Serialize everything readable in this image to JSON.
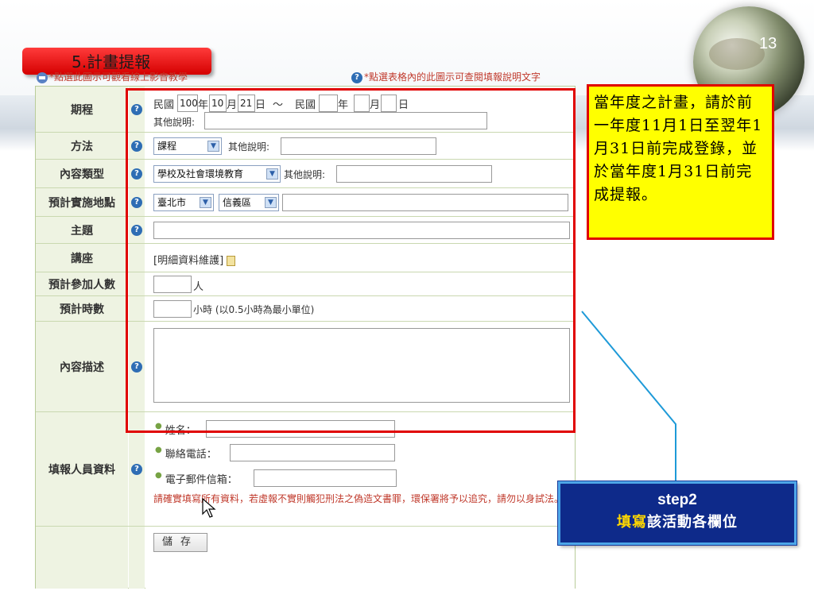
{
  "slide": {
    "page_number": "13",
    "title": "5.計畫提報"
  },
  "links": {
    "video_link": "*點選此圖示可觀看線上影音教學",
    "help_link": "*點選表格內的此圖示可查閱填報說明文字"
  },
  "form": {
    "period": {
      "label": "期程",
      "roc_prefix_1": "民國",
      "start_year": "100",
      "year_unit_1": "年",
      "start_month": "10",
      "month_unit_1": "月",
      "start_day": "21",
      "day_unit_1": "日",
      "tilde": "～",
      "roc_prefix_2": "民國",
      "year_unit_2": "年",
      "month_unit_2": "月",
      "day_unit_2": "日",
      "other_label": "其他說明:"
    },
    "method": {
      "label": "方法",
      "selected": "課程",
      "other_label": "其他說明:"
    },
    "content_type": {
      "label": "內容類型",
      "selected": "學校及社會環境教育",
      "other_label": "其他說明:"
    },
    "location": {
      "label": "預計實施地點",
      "city": "臺北市",
      "district": "信義區"
    },
    "topic": {
      "label": "主題"
    },
    "lecture": {
      "label": "講座",
      "link_text": "[明細資料維護]"
    },
    "participants": {
      "label": "預計參加人數",
      "unit": "人"
    },
    "hours": {
      "label": "預計時數",
      "unit": "小時 (以0.5小時為最小單位)"
    },
    "description": {
      "label": "內容描述"
    },
    "reporter": {
      "label": "填報人員資料",
      "name_label": "姓名：",
      "phone_label": "聯絡電話：",
      "email_label": "電子郵件信箱：",
      "warning": "請確實填寫所有資料，若虛報不實則觸犯刑法之偽造文書罪，環保署將予以追究，請勿以身試法。"
    },
    "save_label": "儲存"
  },
  "note": {
    "text": "當年度之計畫，請於前一年度11月1日至翌年1月31日前完成登錄，並於當年度1月31日前完成提報。"
  },
  "step": {
    "title": "step2",
    "subtitle_highlight": "填寫",
    "subtitle_rest": "該活動各欄位"
  },
  "colors": {
    "highlight_red": "#e00000",
    "note_yellow": "#ffff00",
    "step_navy": "#0e2a8a",
    "label_bg": "#eef3e2"
  }
}
